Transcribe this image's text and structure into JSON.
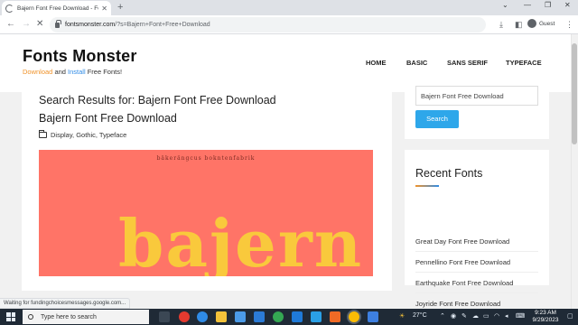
{
  "browser": {
    "tab_title": "Bajern Font Free Download - Fo",
    "url_domain": "fontsmonster.com",
    "url_path": "/?s=Bajern+Font+Free+Download",
    "profile_label": "Guest",
    "status_text": "Waiting for fundingchoicesmessages.google.com..."
  },
  "site": {
    "logo": "Fonts Monster",
    "tagline": {
      "part1": "Download",
      "part2": " and ",
      "part3": "Install",
      "part4": " Free Fonts!"
    },
    "nav": [
      "HOME",
      "BASIC",
      "SANS SERIF",
      "TYPEFACE"
    ]
  },
  "main": {
    "search_heading": "Search Results for: Bajern Font Free Download",
    "post_title": "Bajern Font Free Download",
    "categories": "Display, Gothic, Typeface",
    "banner_small_text": "bäkerängcus bokntenfabrik",
    "banner_big_text": "bajern",
    "banner_color": "#ff7467",
    "banner_text_color": "#f9c93c"
  },
  "sidebar": {
    "search_value": "Bajern Font Free Download",
    "search_button": "Search",
    "recent_title": "Recent Fonts",
    "recent_items": [
      "Great Day Font Free Download",
      "Pennellino Font Free Download",
      "Earthquake Font Free Download",
      "Joyride Font Free Download"
    ]
  },
  "taskbar": {
    "search_placeholder": "Type here to search",
    "temperature": "27°C",
    "time": "9:23 AM",
    "date": "9/29/2023"
  },
  "colors": {
    "accent_orange": "#f0932b",
    "accent_blue": "#2f8be6",
    "button_blue": "#2ea7ea"
  }
}
